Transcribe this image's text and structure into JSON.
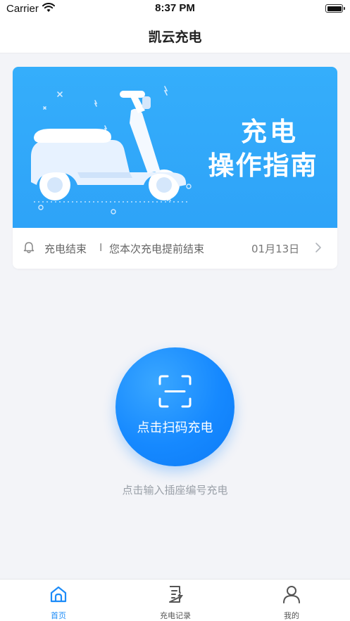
{
  "status_bar": {
    "carrier": "Carrier",
    "time": "8:37 PM"
  },
  "nav": {
    "title": "凯云充电"
  },
  "banner": {
    "line1": "充电",
    "line2": "操作指南",
    "background_color": "#35aefb"
  },
  "notice": {
    "title": "充电结束",
    "separator": "I",
    "message": "您本次充电提前结束",
    "date": "01月13日"
  },
  "scan": {
    "label": "点击扫码充电",
    "color": "#1689ff"
  },
  "manual_entry": {
    "label": "点击输入插座编号充电"
  },
  "tabs": [
    {
      "label": "首页",
      "icon": "home-icon",
      "active": true
    },
    {
      "label": "充电记录",
      "icon": "charge-record-icon",
      "active": false
    },
    {
      "label": "我的",
      "icon": "user-icon",
      "active": false
    }
  ],
  "colors": {
    "accent": "#1689ff",
    "tab_active": "#1d8cf8",
    "tab_inactive": "#555555"
  }
}
